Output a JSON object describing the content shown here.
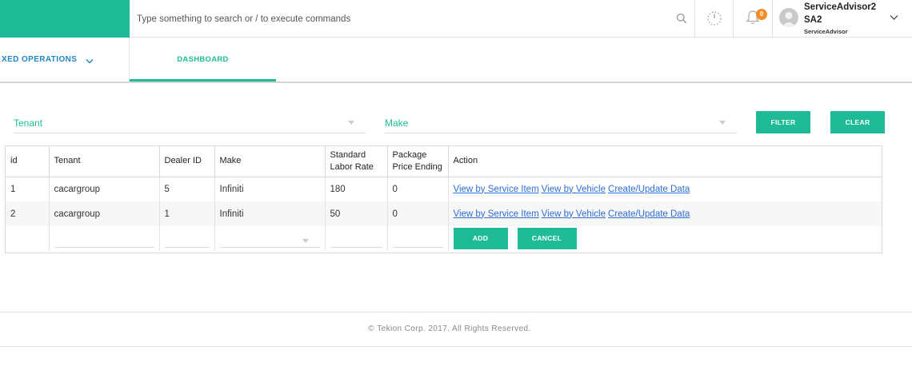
{
  "search": {
    "placeholder": "Type something to search or / to execute commands"
  },
  "notifications": {
    "count": "0"
  },
  "user": {
    "name": "ServiceAdvisor2",
    "code": "SA2",
    "role": "ServiceAdvisor"
  },
  "nav": {
    "module": "XED OPERATIONS",
    "tab": "DASHBOARD"
  },
  "filters": {
    "tenant_label": "Tenant",
    "make_label": "Make",
    "filter_button": "FILTER",
    "clear_button": "CLEAR"
  },
  "grid": {
    "headers": [
      "id",
      "Tenant",
      "Dealer ID",
      "Make",
      "Standard Labor Rate",
      "Package Price Ending",
      "Action"
    ],
    "rows": [
      {
        "id": "1",
        "tenant": "cacargroup",
        "dealer_id": "5",
        "make": "Infiniti",
        "labor_rate": "180",
        "price_ending": "0"
      },
      {
        "id": "2",
        "tenant": "cacargroup",
        "dealer_id": "1",
        "make": "Infiniti",
        "labor_rate": "50",
        "price_ending": "0"
      }
    ],
    "actions": {
      "service_item": "View by Service Item",
      "vehicle": "View by Vehicle",
      "create_update": "Create/Update Data"
    },
    "add_button": "ADD",
    "cancel_button": "CANCEL"
  },
  "footer": {
    "copyright": "© Tekion Corp. 2017. All Rights Reserved."
  },
  "colors": {
    "accent": "#1fbb97",
    "link": "#2f6fd1",
    "nav_blue": "#1e88c7",
    "badge": "#f28c28"
  }
}
